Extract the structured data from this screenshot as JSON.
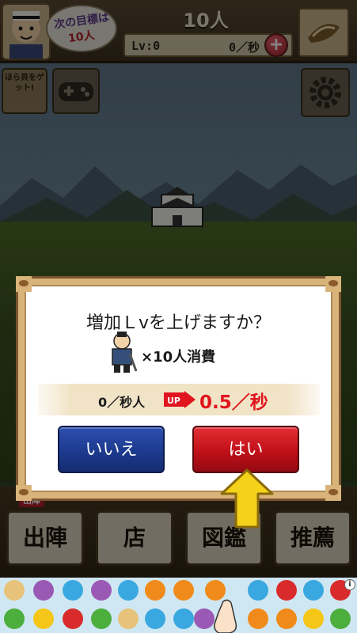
{
  "header": {
    "next_target_label": "次の目標は",
    "next_target_value": "10人",
    "population": "10人",
    "level": "Lv:0",
    "rate": "0／秒",
    "plus": "+"
  },
  "side": {
    "ad_label": "ほら貝をゲット!"
  },
  "menu": {
    "badge": "出陣",
    "items": [
      "出陣",
      "店",
      "図鑑",
      "推薦"
    ]
  },
  "dialog": {
    "title": "増加Ｌvを上げますか？",
    "cost": "×10人消費",
    "rate_before": "0／秒人",
    "up_label": "UP",
    "rate_after": "0.5／秒",
    "no_label": "いいえ",
    "yes_label": "はい"
  },
  "banner": {
    "info": "i"
  },
  "colors": {
    "yes_button": "#c01018",
    "no_button": "#1c3a8e",
    "rate_after": "#e0141e",
    "pointer": "#f4d21a"
  }
}
